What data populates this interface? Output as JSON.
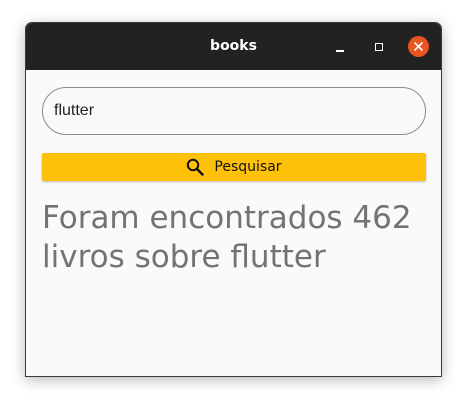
{
  "window": {
    "title": "books",
    "controls": {
      "minimize": "minimize-icon",
      "maximize": "maximize-icon",
      "close": "close-icon"
    },
    "colors": {
      "titlebar": "#222222",
      "close_button": "#e95420",
      "background": "#fafafa"
    }
  },
  "search": {
    "value": "flutter",
    "button_label": "Pesquisar",
    "button_icon": "search-icon",
    "button_color": "#ffc107"
  },
  "result": {
    "text": "Foram encontrados 462 livros sobre flutter"
  }
}
